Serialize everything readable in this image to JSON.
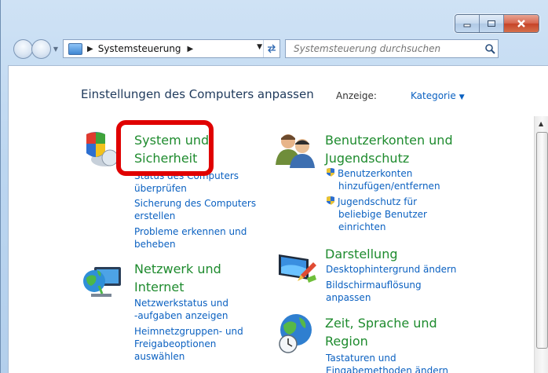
{
  "nav": {
    "breadcrumb": "Systemsteuerung",
    "search_placeholder": "Systemsteuerung durchsuchen"
  },
  "heading": "Einstellungen des Computers anpassen",
  "view": {
    "label": "Anzeige:",
    "value": "Kategorie"
  },
  "left": {
    "system": {
      "title_line1": "System und",
      "title_line2": "Sicherheit",
      "tasks": [
        {
          "line1": "Status des Computers",
          "line2": "überprüfen"
        },
        {
          "line1": "Sicherung des Computers",
          "line2": "erstellen"
        },
        {
          "line1": "Probleme erkennen und",
          "line2": "beheben"
        }
      ]
    },
    "network": {
      "title_line1": "Netzwerk und",
      "title_line2": "Internet",
      "tasks": [
        {
          "line1": "Netzwerkstatus und",
          "line2": "-aufgaben anzeigen"
        },
        {
          "line1": "Heimnetzgruppen- und",
          "line2": "Freigabeoptionen",
          "line3": "auswählen"
        }
      ]
    }
  },
  "right": {
    "accounts": {
      "title_line1": "Benutzerkonten und",
      "title_line2": "Jugendschutz",
      "tasks": [
        {
          "line1": "Benutzerkonten",
          "line2": "hinzufügen/entfernen"
        },
        {
          "line1": "Jugendschutz für",
          "line2": "beliebige Benutzer",
          "line3": "einrichten"
        }
      ]
    },
    "appearance": {
      "title": "Darstellung",
      "tasks": [
        {
          "line1": "Desktophintergrund ändern"
        },
        {
          "line1": "Bildschirmauflösung",
          "line2": "anpassen"
        }
      ]
    },
    "clock": {
      "title_line1": "Zeit, Sprache und",
      "title_line2": "Region",
      "tasks": [
        {
          "line1": "Tastaturen und",
          "line2": "Eingabemethoden ändern"
        }
      ]
    }
  }
}
